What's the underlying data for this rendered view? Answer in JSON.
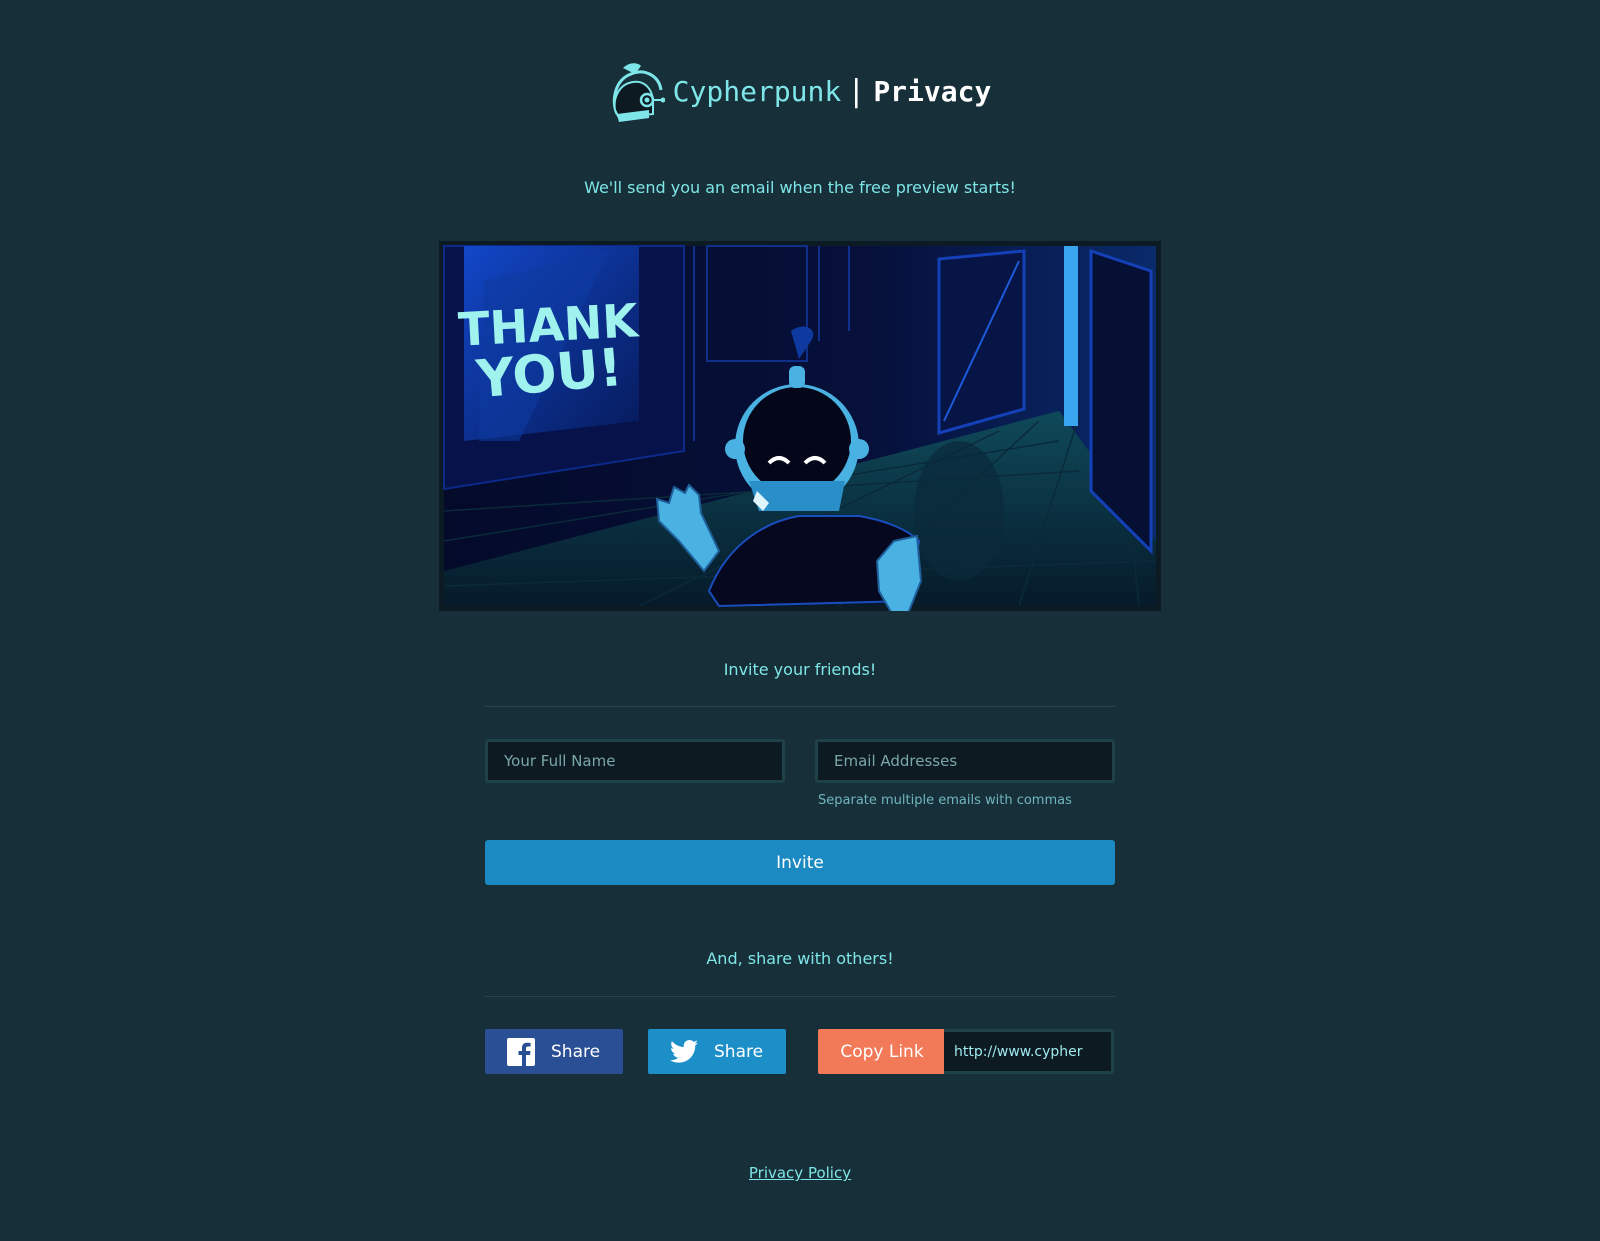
{
  "header": {
    "brand": "Cypherpunk",
    "separator": "|",
    "product": "Privacy",
    "logo_icon": "helmet-robot-icon"
  },
  "tagline": "We'll send you an email when the free preview starts!",
  "hero": {
    "line1": "THANK",
    "line2": "YOU!"
  },
  "invite": {
    "heading": "Invite your friends!",
    "name_placeholder": "Your Full Name",
    "email_placeholder": "Email Addresses",
    "email_hint": "Separate multiple emails with commas",
    "button_label": "Invite"
  },
  "share": {
    "heading": "And, share with others!",
    "facebook_label": "Share",
    "twitter_label": "Share",
    "copy_label": "Copy Link",
    "link_value": "http://www.cypher"
  },
  "footer": {
    "privacy_link": "Privacy Policy"
  },
  "colors": {
    "background": "#172f38",
    "accent": "#7ee6e8",
    "invite_button": "#1b89c2",
    "facebook": "#2a4f94",
    "twitter": "#1d8fc8",
    "copy_link": "#f27a59"
  }
}
